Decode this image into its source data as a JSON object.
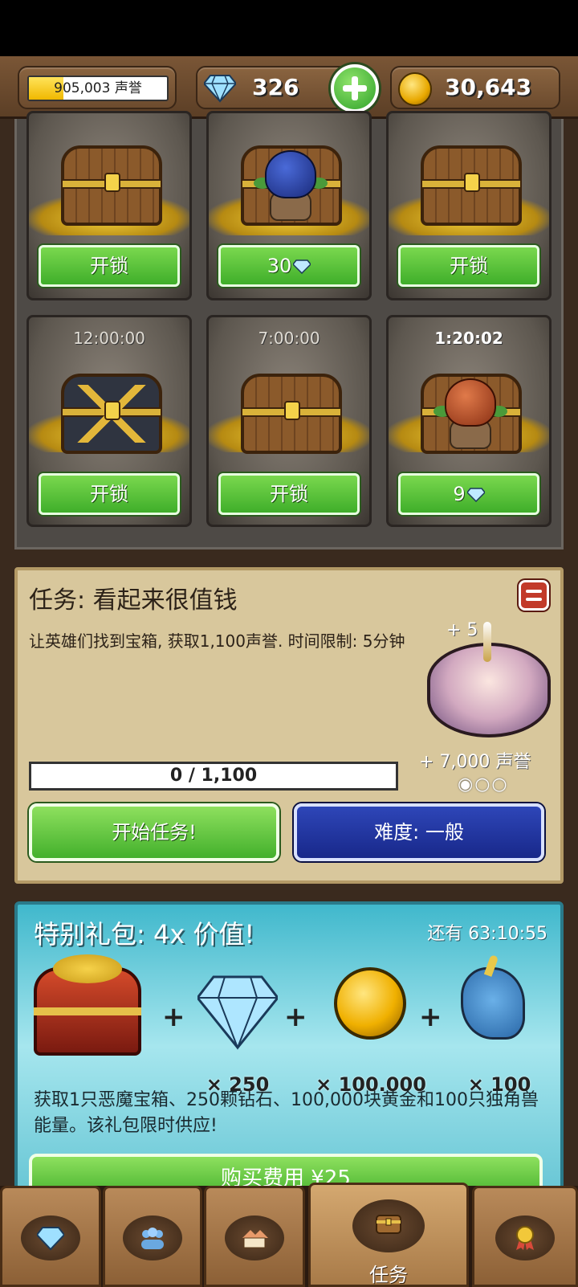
{
  "top_bar": {
    "reputation": {
      "text": "905,003 声誉",
      "progress": 0.25
    },
    "gems": {
      "value": "326"
    },
    "gold": {
      "value": "30,643"
    }
  },
  "chests": [
    {
      "timer": "",
      "button": "开锁",
      "type": "wood"
    },
    {
      "timer": "",
      "button": "30",
      "button_icon": "diamond-icon",
      "type": "goblin-blue"
    },
    {
      "timer": "",
      "button": "开锁",
      "type": "wood"
    },
    {
      "timer": "12:00:00",
      "button": "开锁",
      "type": "dark"
    },
    {
      "timer": "7:00:00",
      "button": "开锁",
      "type": "wood"
    },
    {
      "timer": "1:20:02",
      "button": "9",
      "button_icon": "diamond-icon",
      "type": "goblin-red"
    }
  ],
  "quest": {
    "title": "任务: 看起来很值钱",
    "description": "让英雄们找到宝箱, 获取1,100声誉. 时间限制: 5分钟",
    "reward_gems": "+ 5",
    "reward_reputation": "+ 7,000 声誉",
    "difficulty_dots": "◉○○",
    "progress": {
      "text": "0 / 1,100",
      "current": 0,
      "total": 1100
    },
    "start_button": "开始任务!",
    "difficulty_button": "难度: 一般"
  },
  "offer": {
    "title": "特别礼包: 4x 价值!",
    "timer": "还有 63:10:55",
    "items": [
      {
        "icon": "demon-chest-icon",
        "qty": ""
      },
      {
        "icon": "diamond-icon",
        "qty": "× 250"
      },
      {
        "icon": "gold-coin-icon",
        "qty": "× 100.000"
      },
      {
        "icon": "unicorn-icon",
        "qty": "× 100"
      }
    ],
    "description": "获取1只恶魔宝箱、250颗钻石、100,000块黄金和100只独角兽能量。该礼包限时供应!",
    "buy_button": "购买费用 ¥25"
  },
  "nav": {
    "tabs": [
      {
        "icon": "diamond-icon",
        "label": ""
      },
      {
        "icon": "heroes-icon",
        "label": ""
      },
      {
        "icon": "village-icon",
        "label": ""
      },
      {
        "icon": "chest-icon",
        "label": "任务",
        "active": true
      },
      {
        "icon": "medal-icon",
        "label": ""
      }
    ]
  },
  "colors": {
    "button_green": "#43b02c",
    "button_blue": "#18288a",
    "panel_tan": "#d8c79c",
    "offer_teal": "#40b8cc"
  }
}
